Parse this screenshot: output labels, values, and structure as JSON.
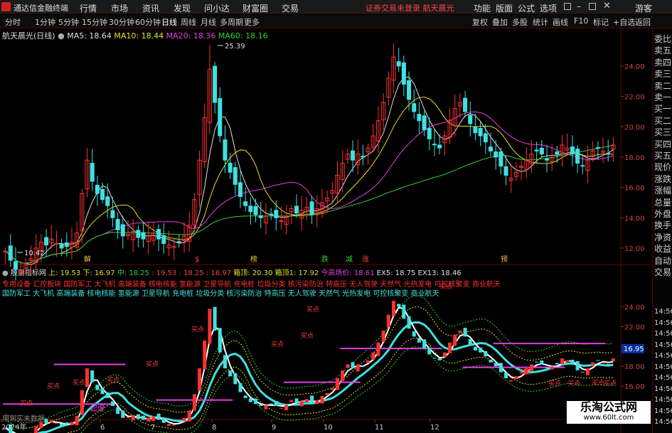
{
  "menubar": {
    "app_title": "通达信金融终端",
    "items": [
      "行情",
      "市场",
      "资讯",
      "发现",
      "问小达",
      "财富圈",
      "交易"
    ],
    "login": "证券交易未登录  航天晨光",
    "right_items": [
      "功能",
      "版面",
      "公式",
      "选项"
    ],
    "guest": "游客"
  },
  "toolbar": {
    "periods": [
      "分时",
      "1分钟",
      "5分钟",
      "15分钟",
      "30分钟",
      "60分钟",
      "日线",
      "周线",
      "月线",
      "多周期",
      "更多"
    ],
    "active_period": "日线",
    "right_tools": [
      "复权",
      "叠加",
      "多股",
      "统计",
      "画线",
      "F10",
      "标记",
      "+自选",
      "返回"
    ]
  },
  "main_chart": {
    "stock_label": "航天晨光(日线)",
    "ma": [
      {
        "name": "MA5",
        "value": "18.64",
        "color": "#e0e0e0"
      },
      {
        "name": "MA10",
        "value": "18.44",
        "color": "#e8e020"
      },
      {
        "name": "MA20",
        "value": "18.36",
        "color": "#e040e0"
      },
      {
        "name": "MA60",
        "value": "18.16",
        "color": "#30d030"
      }
    ],
    "high_label": "25.39",
    "low_label": "10.42",
    "price_ticks": [
      "24.00",
      "22.00",
      "20.00",
      "18.00",
      "16.00",
      "14.00",
      "12.00"
    ],
    "event_marks": [
      {
        "text": "解",
        "color": "#e0c040"
      },
      {
        "text": "$",
        "color": "#ff4040"
      },
      {
        "text": "榜",
        "color": "#e0c040"
      },
      {
        "text": "跌",
        "color": "#30d030"
      },
      {
        "text": "减",
        "color": "#30d030"
      },
      {
        "text": "涨",
        "color": "#ff4040"
      },
      {
        "text": "预",
        "color": "#e0c040"
      }
    ]
  },
  "sub_chart": {
    "indicator_name": "殷朋指标网",
    "values": [
      {
        "text": "上: 19.53",
        "color": "#e8e020"
      },
      {
        "text": "下: 16.97",
        "color": "#e8e020"
      },
      {
        "text": "中: 18.25",
        "color": "#30d030"
      },
      {
        "text": ": 19.53",
        "color": "#ff4040"
      },
      {
        "text": ": 18.25",
        "color": "#ff4040"
      },
      {
        "text": ": 16.97",
        "color": "#ff4040"
      },
      {
        "text": "箱顶: 20.30",
        "color": "#e8e020"
      },
      {
        "text": "箱顶1: 17.92",
        "color": "#e8e020"
      },
      {
        "text": "今高场价: 18.61",
        "color": "#e040e0"
      },
      {
        "text": "EX5: 18.75",
        "color": "#e0e0e0"
      },
      {
        "text": "EX13: 18.46",
        "color": "#e0e0e0"
      }
    ],
    "concept_line_1": "专用设备 汇控板块 国防军工 大飞机 高端装备 核电核能 氢能源 卫星导航 充电桩 垃圾分类 核污染防治 特高压 无人驾驶 天然气 光热发电 可控核聚变 商业航天",
    "concept_line_2": "国防军工 大飞机 高端装备 核电核能 氢能源 卫星导航 充电桩 垃圾分类 核污染防治 特高压 无人驾驶 天然气 光热发电 可控核聚变 商业航天",
    "price_ticks": [
      "24.00",
      "22.00",
      "20.00",
      "18.00",
      "16.00",
      "14.00"
    ],
    "current_price": "16.95",
    "signal_labels": [
      "买点",
      "买点",
      "买点",
      "买点",
      "买点",
      "买点",
      "买点",
      "买点"
    ],
    "burst_label": "起爆"
  },
  "time_axis": {
    "labels": [
      "2024年",
      "6",
      "7",
      "8",
      "9",
      "10",
      "11",
      "12"
    ]
  },
  "right_panel": {
    "items": [
      "委比",
      "卖五",
      "卖四",
      "卖三",
      "卖二",
      "卖一",
      "买一",
      "买二",
      "买三",
      "买四",
      "买五",
      "现价",
      "涨跌",
      "涨幅",
      "总量",
      "外盘",
      "换手",
      "净资",
      "收益",
      "自动",
      "交易"
    ],
    "times": [
      "14:56",
      "14:56",
      "14:56",
      "14:56",
      "14:56",
      "14:56",
      "14:56",
      "14:56",
      "14:56",
      "14:56",
      "14:56"
    ]
  },
  "footer": {
    "left_text": "用到实未数据",
    "watermark_main": "乐淘公式网",
    "watermark_sub": "www.60lt.com"
  },
  "chart_data": {
    "type": "candlestick",
    "title": "航天晨光(日线)",
    "high": 25.39,
    "low": 10.42,
    "ylim": [
      11.2,
      26.2
    ],
    "close_series": [
      11.8,
      11.2,
      10.6,
      10.5,
      10.9,
      11.3,
      12.0,
      12.4,
      12.2,
      12.6,
      12.3,
      12.0,
      12.1,
      12.4,
      13.0,
      15.6,
      17.8,
      16.4,
      15.6,
      15.2,
      14.8,
      14.0,
      13.2,
      12.8,
      12.9,
      13.1,
      12.7,
      12.6,
      12.8,
      13.0,
      12.6,
      12.3,
      12.2,
      12.1,
      12.4,
      12.8,
      13.5,
      15.2,
      17.8,
      20.6,
      23.8,
      21.6,
      19.4,
      17.8,
      17.0,
      16.2,
      15.4,
      14.8,
      14.4,
      14.2,
      14.0,
      14.1,
      14.2,
      14.0,
      13.8,
      14.1,
      14.6,
      14.3,
      14.5,
      14.7,
      14.2,
      14.6,
      15.0,
      15.3,
      15.8,
      16.8,
      17.6,
      18.2,
      17.8,
      18.2,
      18.0,
      18.6,
      19.4,
      20.4,
      21.6,
      23.2,
      24.6,
      24.0,
      22.8,
      21.8,
      21.0,
      20.4,
      19.8,
      19.2,
      18.8,
      18.6,
      19.4,
      20.4,
      21.2,
      21.6,
      21.0,
      20.2,
      19.6,
      19.4,
      19.0,
      18.4,
      18.0,
      17.4,
      16.8,
      16.6,
      17.0,
      17.4,
      17.8,
      18.2,
      18.4,
      18.2,
      17.8,
      18.0,
      18.2,
      18.8,
      18.6,
      18.2,
      17.6,
      17.4,
      17.8,
      18.4,
      18.6,
      18.4,
      18.2,
      18.8
    ]
  }
}
